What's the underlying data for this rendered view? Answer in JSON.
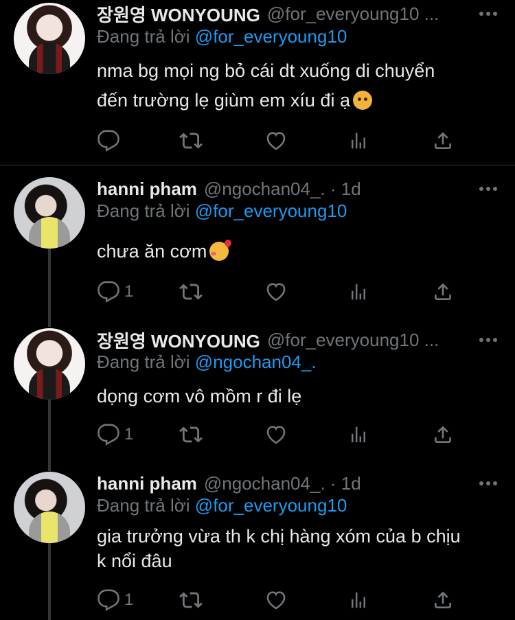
{
  "tweets": [
    {
      "name": "장원영 WONYOUNG",
      "handle": "@for_everyoung10 ...",
      "reply_prefix": "Đang trả lời",
      "reply_to": "@for_everyoung10",
      "text_lines": [
        "nma bg mọi ng bỏ cái dt xuống di chuyển",
        "đến trường lẹ giùm em xíu đi ạ"
      ],
      "emoji": "angry-face-emoji",
      "reply_count": ""
    },
    {
      "name": "hanni pham",
      "handle": "@ngochan04_. · 1d",
      "reply_prefix": "Đang trả lời",
      "reply_to": "@for_everyoung10",
      "text_lines": [
        "chưa ăn cơm"
      ],
      "emoji": "smiling-face-with-hearts-emoji",
      "reply_count": "1"
    },
    {
      "name": "장원영 WONYOUNG",
      "handle": "@for_everyoung10 ...",
      "reply_prefix": "Đang trả lời",
      "reply_to": "@ngochan04_.",
      "text_lines": [
        "dọng cơm vô mồm r đi lẹ"
      ],
      "reply_count": "1"
    },
    {
      "name": "hanni pham",
      "handle": "@ngochan04_. · 1d",
      "reply_prefix": "Đang trả lời",
      "reply_to": "@for_everyoung10",
      "text_lines": [
        "gia trưởng vừa th k chị hàng xóm của b chịu",
        "k nổi đâu"
      ],
      "reply_count": "1"
    }
  ],
  "colors": {
    "background": "#000000",
    "text": "#e7e9ea",
    "muted": "#71767b",
    "link": "#1d9bf0",
    "divider": "#2f3336"
  }
}
